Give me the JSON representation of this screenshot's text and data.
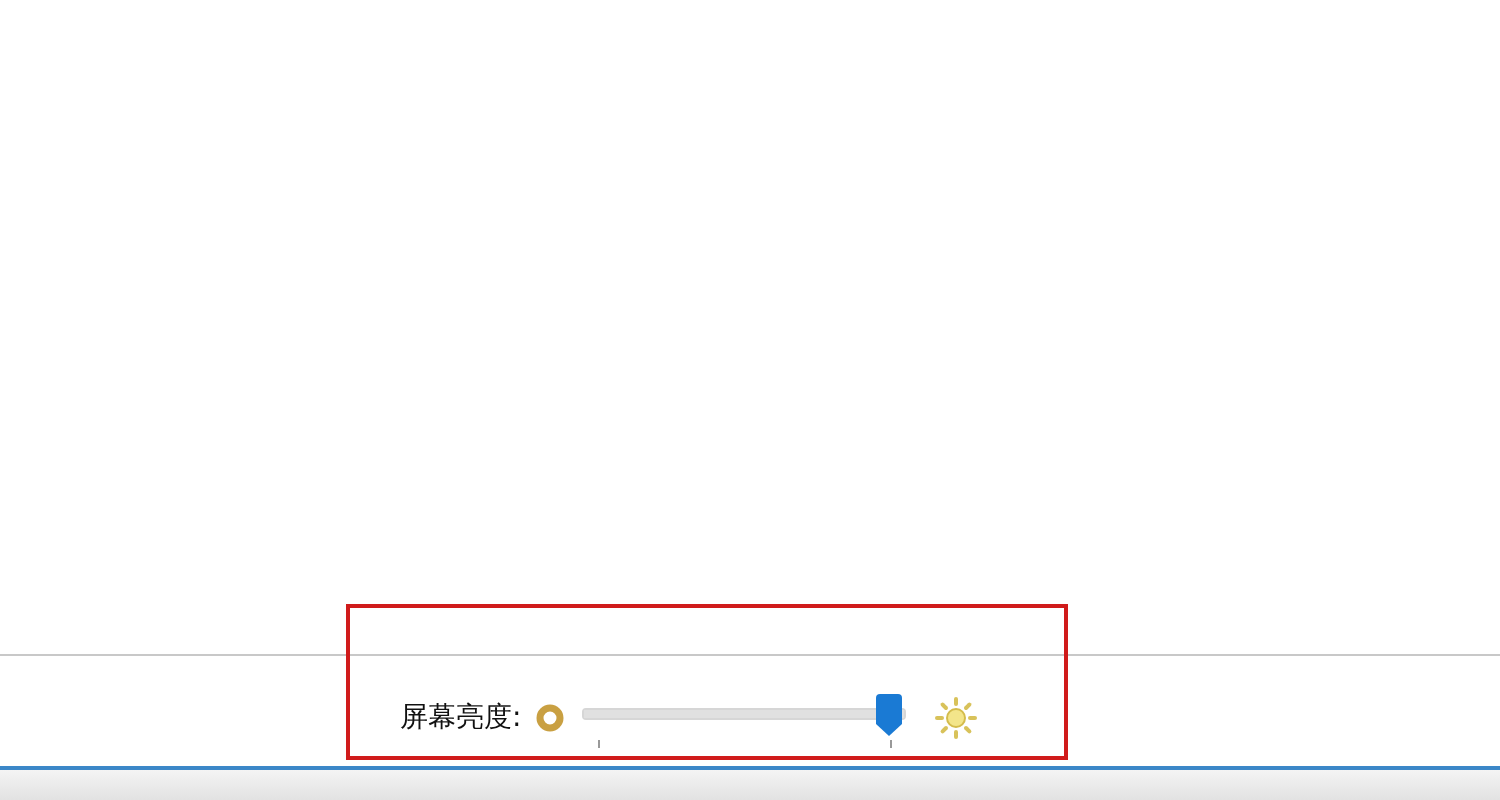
{
  "brightness_bar": {
    "label": "屏幕亮度:",
    "level": 1
  }
}
